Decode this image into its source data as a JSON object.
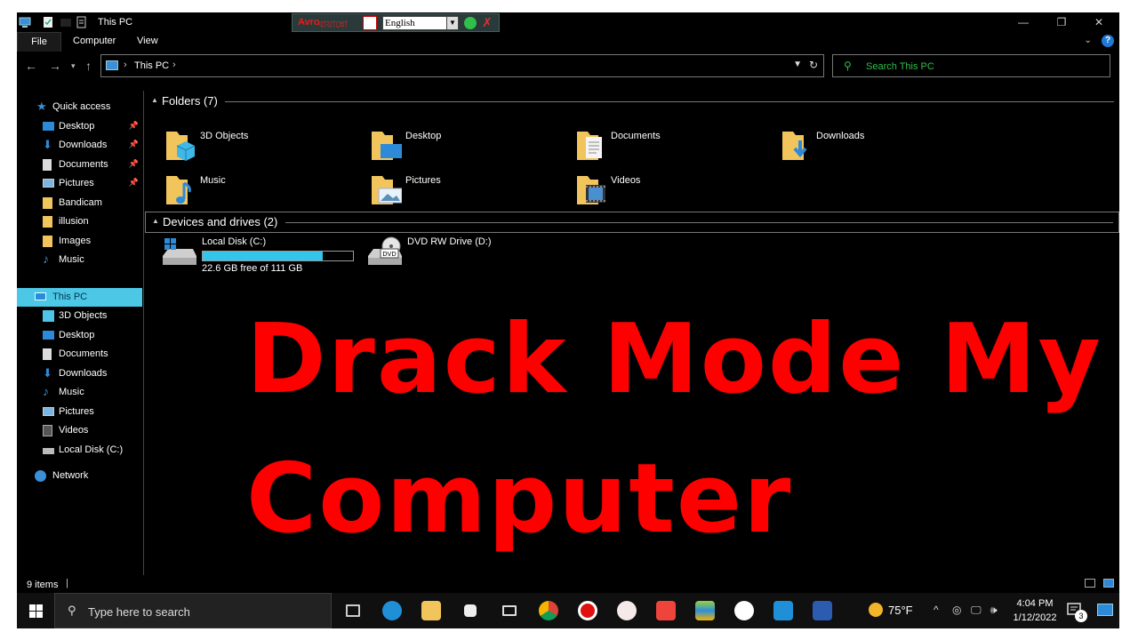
{
  "window": {
    "title": "This PC",
    "controls": {
      "minimize": "—",
      "maximize": "❐",
      "close": "✕"
    }
  },
  "ime": {
    "logo": "Avro",
    "name": "বায়ান্নো",
    "language": "English"
  },
  "ribbon": {
    "tabs": [
      "File",
      "Computer",
      "View"
    ]
  },
  "address": {
    "path": "This PC",
    "search_placeholder": "Search This PC"
  },
  "sidebar": {
    "items": [
      {
        "label": "Quick access",
        "icon": "star-icon",
        "pinned": false
      },
      {
        "label": "Desktop",
        "icon": "desktop-icon",
        "pinned": true
      },
      {
        "label": "Downloads",
        "icon": "download-icon",
        "pinned": true
      },
      {
        "label": "Documents",
        "icon": "document-icon",
        "pinned": true
      },
      {
        "label": "Pictures",
        "icon": "pictures-icon",
        "pinned": true
      },
      {
        "label": "Bandicam",
        "icon": "folder-icon",
        "pinned": false
      },
      {
        "label": "illusion",
        "icon": "folder-icon",
        "pinned": false
      },
      {
        "label": "Images",
        "icon": "folder-icon",
        "pinned": false
      },
      {
        "label": "Music",
        "icon": "music-icon",
        "pinned": false
      },
      {
        "label": "This PC",
        "icon": "computer-icon",
        "pinned": false,
        "selected": true
      },
      {
        "label": "3D Objects",
        "icon": "cube-icon",
        "pinned": false
      },
      {
        "label": "Desktop",
        "icon": "desktop-icon",
        "pinned": false
      },
      {
        "label": "Documents",
        "icon": "document-icon",
        "pinned": false
      },
      {
        "label": "Downloads",
        "icon": "download-icon",
        "pinned": false
      },
      {
        "label": "Music",
        "icon": "music-icon",
        "pinned": false
      },
      {
        "label": "Pictures",
        "icon": "pictures-icon",
        "pinned": false
      },
      {
        "label": "Videos",
        "icon": "video-icon",
        "pinned": false
      },
      {
        "label": "Local Disk (C:)",
        "icon": "drive-icon",
        "pinned": false
      },
      {
        "label": "Network",
        "icon": "network-icon",
        "pinned": false
      }
    ]
  },
  "folders_group": {
    "title": "Folders (7)",
    "items": [
      {
        "label": "3D Objects",
        "icon": "cube-folder-icon"
      },
      {
        "label": "Desktop",
        "icon": "desktop-folder-icon"
      },
      {
        "label": "Documents",
        "icon": "documents-folder-icon"
      },
      {
        "label": "Downloads",
        "icon": "downloads-folder-icon"
      },
      {
        "label": "Music",
        "icon": "music-folder-icon"
      },
      {
        "label": "Pictures",
        "icon": "pictures-folder-icon"
      },
      {
        "label": "Videos",
        "icon": "videos-folder-icon"
      }
    ]
  },
  "devices_group": {
    "title": "Devices and drives (2)",
    "drives": [
      {
        "label": "Local Disk (C:)",
        "free_text": "22.6 GB free of 111 GB",
        "used_fraction": 0.8,
        "icon": "windows-drive-icon"
      },
      {
        "label": "DVD RW Drive (D:)",
        "icon": "dvd-drive-icon",
        "icon_text": "DVD"
      }
    ]
  },
  "overlay": {
    "line1": "Drack Mode My",
    "line2": "Computer",
    "color": "#ff0000"
  },
  "status": {
    "items_text": "9 items"
  },
  "taskbar": {
    "search_placeholder": "Type here to search",
    "apps": [
      "task-view-icon",
      "edge-icon",
      "file-explorer-icon",
      "store-icon",
      "mail-icon",
      "chrome-icon",
      "recorder-icon",
      "paint-icon",
      "anydesk-icon",
      "bluestacks-icon",
      "signal-icon",
      "vscode-icon",
      "word-icon"
    ],
    "weather": "75°F",
    "time": "4:04 PM",
    "date": "1/12/2022",
    "notifications": "3"
  },
  "colors": {
    "background": "#000000",
    "accent": "#4cc8e6",
    "search_text": "#2fbf4a",
    "drive_bar": "#33c6ea"
  }
}
